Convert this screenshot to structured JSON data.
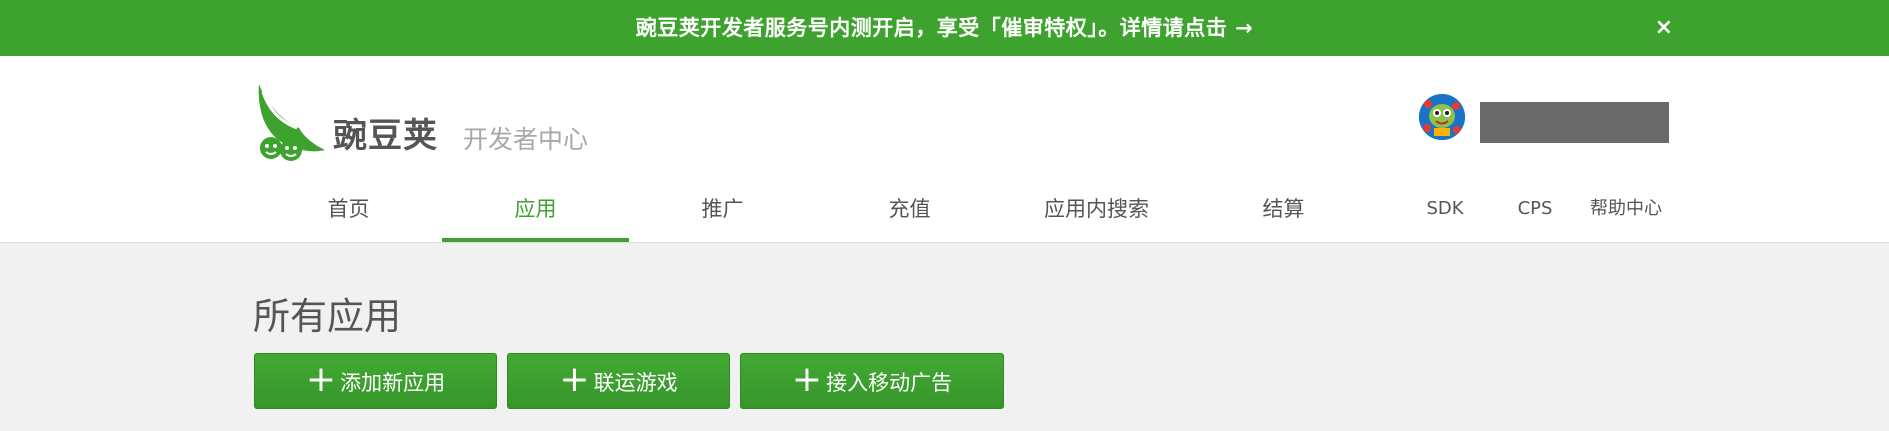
{
  "banner": {
    "text": "豌豆荚开发者服务号内测开启，享受「催审特权」。详情请点击 →",
    "close": "×"
  },
  "logo": {
    "name": "豌豆荚",
    "subtitle": "开发者中心"
  },
  "nav": {
    "items": [
      {
        "label": "首页",
        "active": false
      },
      {
        "label": "应用",
        "active": true
      },
      {
        "label": "推广",
        "active": false
      },
      {
        "label": "充值",
        "active": false
      },
      {
        "label": "应用内搜索",
        "active": false
      },
      {
        "label": "结算",
        "active": false
      },
      {
        "label": "SDK",
        "active": false
      },
      {
        "label": "CPS",
        "active": false
      },
      {
        "label": "帮助中心",
        "active": false
      }
    ]
  },
  "page": {
    "title": "所有应用"
  },
  "actions": {
    "plus_glyph": "+",
    "add_app": "添加新应用",
    "joint_game": "联运游戏",
    "mobile_ads": "接入移动广告"
  },
  "colors": {
    "brand_green": "#3ea22e",
    "masked_username": "#6a6a6a"
  }
}
